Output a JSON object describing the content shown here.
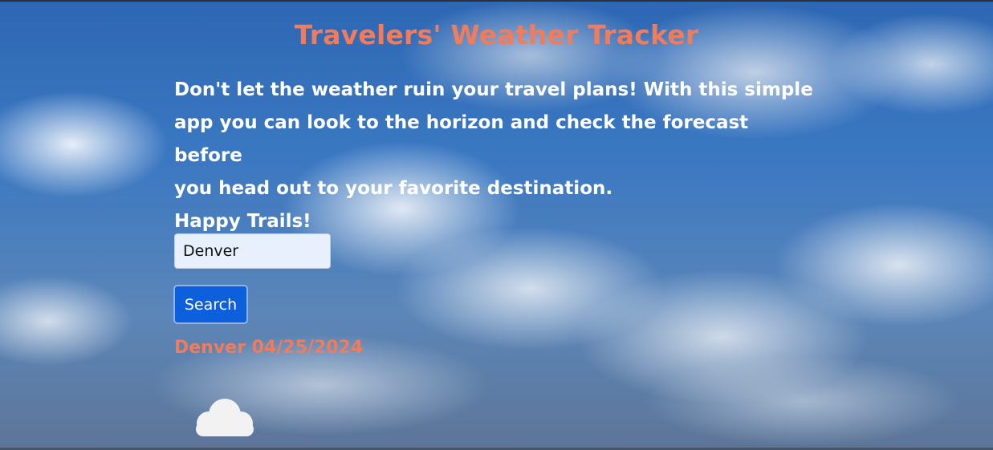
{
  "header": {
    "title": "Travelers' Weather Tracker"
  },
  "intro": {
    "lines": [
      "Don't let the weather ruin your travel plans! With this simple",
      "app you can look to the horizon and check the forecast before",
      "you head out to your favorite destination.",
      "Happy Trails!"
    ]
  },
  "search": {
    "value": "Denver",
    "button_label": "Search"
  },
  "result": {
    "heading": "Denver 04/25/2024",
    "icon": "cloud-icon"
  },
  "colors": {
    "accent": "#f07c5c",
    "button": "#0d5fdb",
    "input_bg": "#e8effd"
  }
}
